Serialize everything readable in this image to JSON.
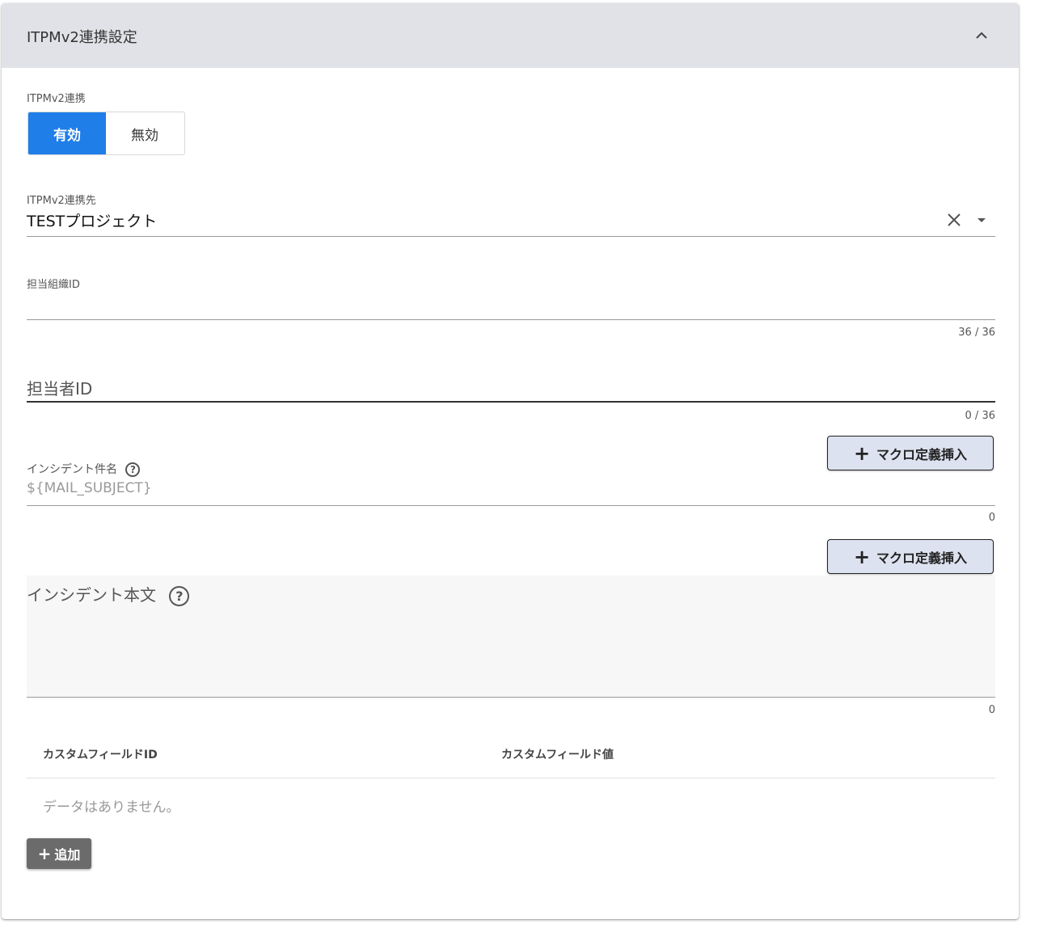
{
  "panel": {
    "title": "ITPMv2連携設定"
  },
  "integration": {
    "label": "ITPMv2連携",
    "enabled_label": "有効",
    "disabled_label": "無効",
    "selected": "有効"
  },
  "destination": {
    "label": "ITPMv2連携先",
    "value": "TESTプロジェクト"
  },
  "org_id": {
    "label": "担当組織ID",
    "value": "",
    "counter": "36 / 36"
  },
  "assignee_id": {
    "label": "担当者ID",
    "value": "",
    "counter": "0 / 36"
  },
  "incident_subject": {
    "label": "インシデント件名",
    "value": "${MAIL_SUBJECT}",
    "counter": "0",
    "macro_button": "マクロ定義挿入"
  },
  "incident_body": {
    "label": "インシデント本文",
    "value": "",
    "counter": "0",
    "macro_button": "マクロ定義挿入"
  },
  "custom_fields": {
    "columns": [
      "カスタムフィールドID",
      "カスタムフィールド値"
    ],
    "empty_message": "データはありません。",
    "add_button": "追加"
  }
}
